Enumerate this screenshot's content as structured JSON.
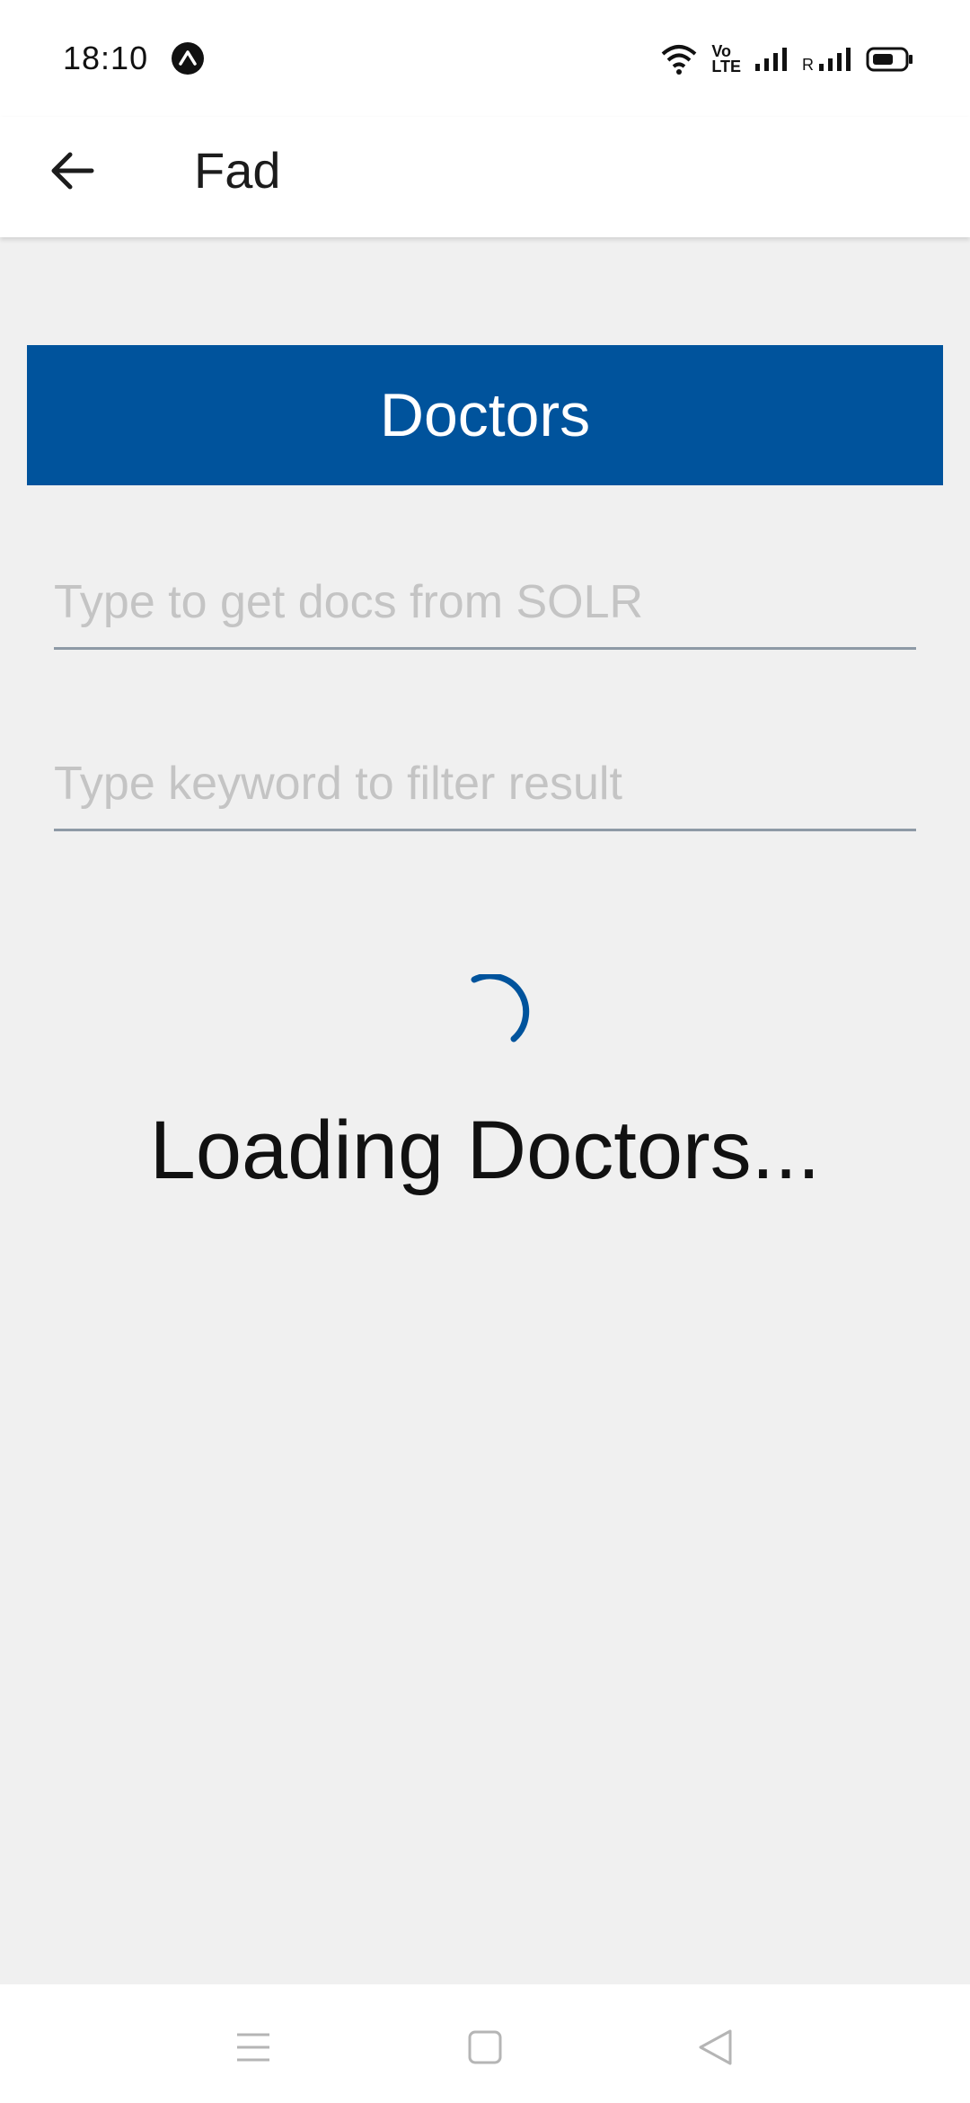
{
  "status_bar": {
    "time": "18:10",
    "volte_label_top": "Vo",
    "volte_label_bottom": "LTE",
    "roaming_label": "R"
  },
  "app_bar": {
    "title": "Fad",
    "back_icon": "arrow-left-icon"
  },
  "main": {
    "doctors_button_label": "Doctors",
    "search_input": {
      "value": "",
      "placeholder": "Type to get docs from SOLR"
    },
    "filter_input": {
      "value": "",
      "placeholder": "Type keyword to filter result"
    },
    "loading_text": "Loading Doctors..."
  },
  "nav_bar": {
    "icons": [
      "menu-icon",
      "home-square-icon",
      "back-triangle-icon"
    ]
  },
  "colors": {
    "accent": "#00539c",
    "background": "#f0f0f0",
    "placeholder": "#c4c4c4"
  }
}
